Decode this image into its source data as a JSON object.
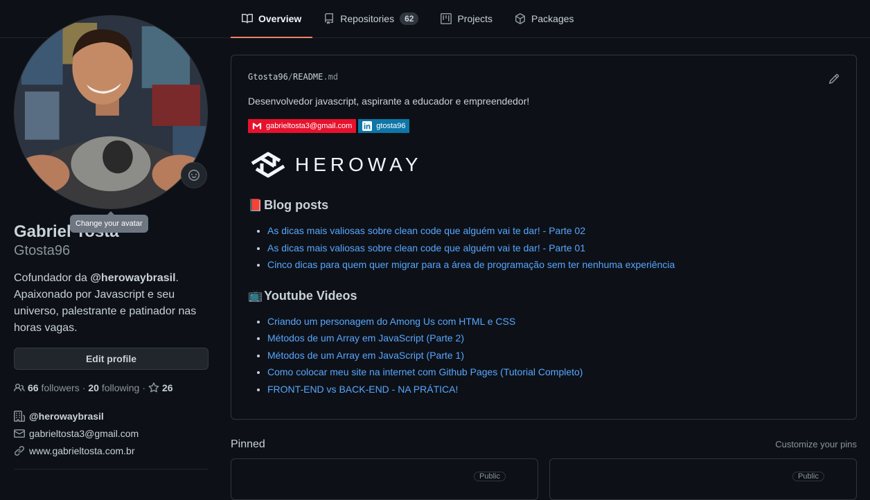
{
  "nav": {
    "tabs": [
      {
        "label": "Overview",
        "icon": "book-icon",
        "active": true
      },
      {
        "label": "Repositories",
        "icon": "repo-icon",
        "count": "62"
      },
      {
        "label": "Projects",
        "icon": "project-icon"
      },
      {
        "label": "Packages",
        "icon": "package-icon"
      }
    ]
  },
  "profile": {
    "avatar_tooltip": "Change your avatar",
    "full_name": "Gabriel Tosta",
    "login": "Gtosta96",
    "bio_prefix": "Cofundador da ",
    "bio_mention": "@herowaybrasil",
    "bio_rest": ". Apaixonado por Javascript e seu universo, palestrante e patinador nas horas vagas.",
    "edit_label": "Edit profile",
    "followers_count": "66",
    "followers_label": "followers",
    "following_count": "20",
    "following_label": "following",
    "stars_count": "26",
    "organization": "@herowaybrasil",
    "email": "gabrieltosta3@gmail.com",
    "website": "www.gabrieltosta.com.br"
  },
  "readme": {
    "owner": "Gtosta96",
    "separator": "/",
    "file_name": "README",
    "file_ext": ".md",
    "intro": "Desenvolvedor javascript, aspirante a educador e empreendedor!",
    "badge_email": "gabrieltosta3@gmail.com",
    "badge_linkedin": "gtosta96",
    "logo_text": "HEROWAY",
    "blog_emoji": "📕",
    "blog_title": "Blog posts",
    "blog_posts": [
      "As dicas mais valiosas sobre clean code que alguém vai te dar! - Parte 02",
      "As dicas mais valiosas sobre clean code que alguém vai te dar! - Parte 01",
      "Cinco dicas para quem quer migrar para a área de programação sem ter nenhuma experiência"
    ],
    "videos_emoji": "📺",
    "videos_title": "Youtube Videos",
    "videos": [
      "Criando um personagem do Among Us com HTML e CSS",
      "Métodos de um Array em JavaScript (Parte 2)",
      "Métodos de um Array em JavaScript (Parte 1)",
      "Como colocar meu site na internet com Github Pages (Tutorial Completo)",
      "FRONT-END vs BACK-END - NA PRÁTICA!"
    ]
  },
  "pinned": {
    "title": "Pinned",
    "customize": "Customize your pins",
    "badge": "Public"
  },
  "colors": {
    "background": "#0d1117",
    "link": "#58a6ff",
    "active_tab_underline": "#f78166",
    "gmail_badge": "#e8112d",
    "linkedin_badge": "#0e76a8"
  }
}
